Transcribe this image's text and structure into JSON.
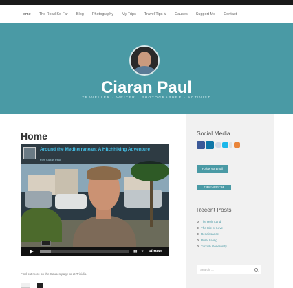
{
  "nav": {
    "items": [
      {
        "label": "Home"
      },
      {
        "label": "The Road So Far"
      },
      {
        "label": "Blog"
      },
      {
        "label": "Photography"
      },
      {
        "label": "My Trips"
      },
      {
        "label": "Travel Tips  ∨"
      },
      {
        "label": "Causes"
      },
      {
        "label": "Support Me"
      },
      {
        "label": "Contact"
      }
    ]
  },
  "hero": {
    "name": "Ciaran Paul",
    "tagline": "TRAVELLER · WRITER · PHOTOGRAPHER · ACTIVIST"
  },
  "main": {
    "title": "Home",
    "video": {
      "title": "Around the Mediterranean: A Hitchhiking Adventure",
      "byline": "from Ciaran Paul",
      "progress": 0.12,
      "brand": "vimeo"
    },
    "find_text": "Find out more on the Causes page or at Trinidio."
  },
  "sidebar": {
    "social_title": "Social Media",
    "follow_email": "Follow via Email",
    "follow_twitter": "Follow Ciaran Paul",
    "recent_title": "Recent Posts",
    "posts": [
      {
        "label": "The Holy Land"
      },
      {
        "label": "The Isle of Love"
      },
      {
        "label": "Renaissance"
      },
      {
        "label": "Rural Living"
      },
      {
        "label": "Turkish Generosity"
      }
    ],
    "search_placeholder": "Search …"
  },
  "colors": {
    "accent": "#4a9aa5",
    "video_title": "#44c1e8"
  }
}
